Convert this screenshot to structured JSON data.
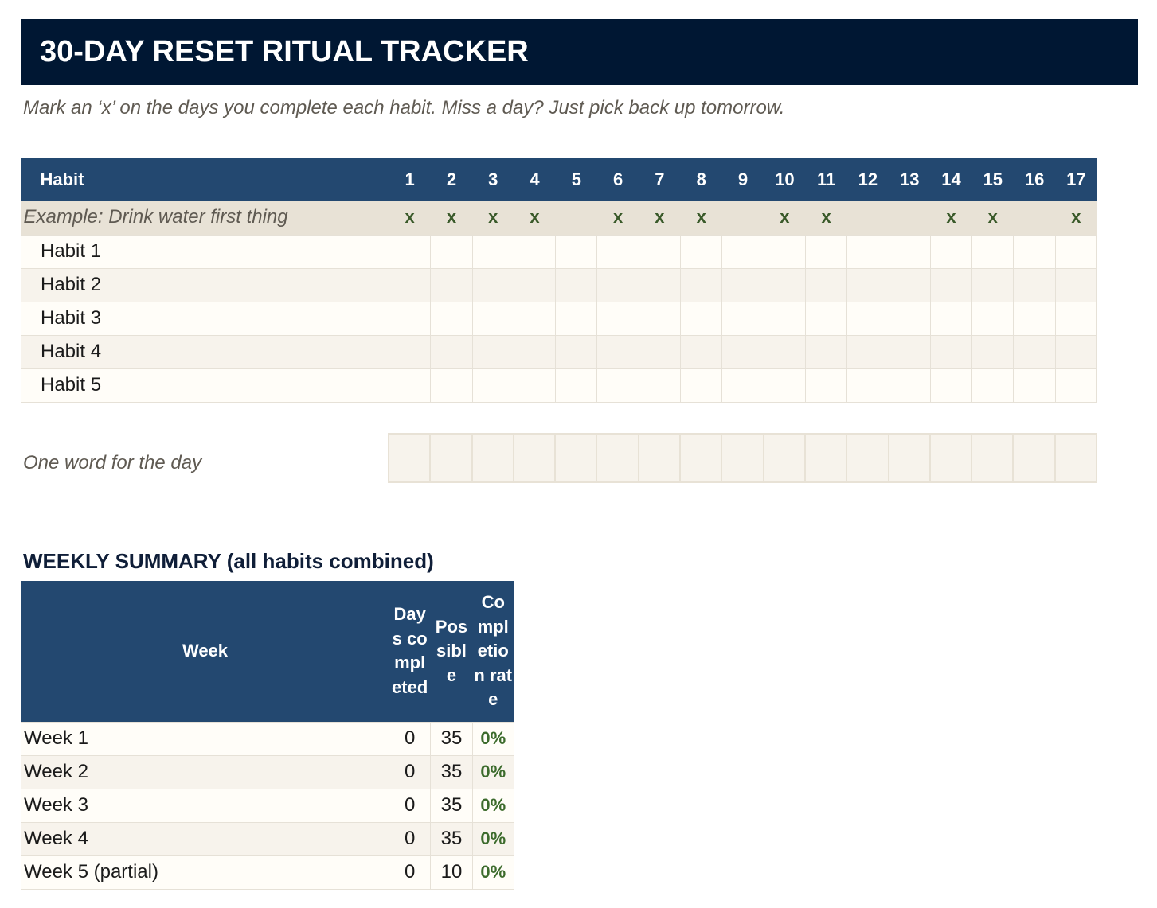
{
  "title": "30-DAY RESET RITUAL TRACKER",
  "subtitle": "Mark an ‘x’ on the days you complete each habit. Miss a day? Just pick back up tomorrow.",
  "tracker": {
    "habit_header": "Habit",
    "days": [
      "1",
      "2",
      "3",
      "4",
      "5",
      "6",
      "7",
      "8",
      "9",
      "10",
      "11",
      "12",
      "13",
      "14",
      "15",
      "16",
      "17"
    ],
    "example": {
      "label": "Example: Drink water first thing",
      "marks": [
        "x",
        "x",
        "x",
        "x",
        "",
        "x",
        "x",
        "x",
        "",
        "x",
        "x",
        "",
        "",
        "x",
        "x",
        "",
        "x"
      ]
    },
    "habits": [
      "Habit 1",
      "Habit 2",
      "Habit 3",
      "Habit 4",
      "Habit 5"
    ]
  },
  "one_word": {
    "label": "One word for the day"
  },
  "weekly_summary": {
    "title": "WEEKLY SUMMARY (all habits combined)",
    "headers": {
      "week": "Week",
      "days_completed": "Days completed",
      "possible": "Possible",
      "completion_rate": "Completion rate"
    },
    "rows": [
      {
        "week": "Week 1",
        "days_completed": "0",
        "possible": "35",
        "rate": "0%"
      },
      {
        "week": "Week 2",
        "days_completed": "0",
        "possible": "35",
        "rate": "0%"
      },
      {
        "week": "Week 3",
        "days_completed": "0",
        "possible": "35",
        "rate": "0%"
      },
      {
        "week": "Week 4",
        "days_completed": "0",
        "possible": "35",
        "rate": "0%"
      },
      {
        "week": "Week 5 (partial)",
        "days_completed": "0",
        "possible": "10",
        "rate": "0%"
      }
    ]
  },
  "colors": {
    "title_bg": "#001733",
    "header_bg": "#234870",
    "example_bg": "#e8e2d6",
    "mark": "#3a5a2a",
    "rate": "#3c6b2c"
  }
}
